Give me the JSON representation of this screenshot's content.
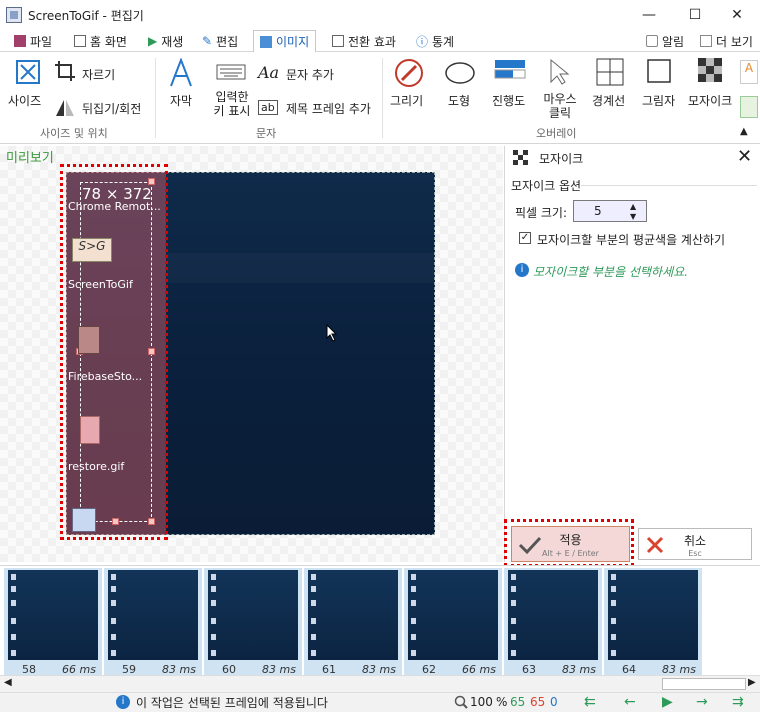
{
  "window": {
    "title": "ScreenToGif - 편집기",
    "minimize": "—",
    "maximize": "☐",
    "close": "✕"
  },
  "tabs": [
    {
      "label": "파일"
    },
    {
      "label": "홈 화면"
    },
    {
      "label": "재생"
    },
    {
      "label": "편집"
    },
    {
      "label": "이미지"
    },
    {
      "label": "전환 효과"
    },
    {
      "label": "통계"
    }
  ],
  "tabs_right": {
    "alarm": "알림",
    "more": "더 보기"
  },
  "ribbon": {
    "size_pos": {
      "resize": "사이즈",
      "crop": "자르기",
      "flip": "뒤집기/회전",
      "group": "사이즈 및 위치"
    },
    "text": {
      "caption": "자막",
      "keystrokes": "입력한 키 표시",
      "free_text": "문자 추가",
      "title_frame": "제목 프레임 추가",
      "group": "문자",
      "aa": "Aa",
      "ab": "ab"
    },
    "overlay": {
      "draw": "그리기",
      "shape": "도형",
      "progress": "진행도",
      "mouse_clicks": "마우스 클릭",
      "border": "경계선",
      "shadow": "그림자",
      "obfuscate": "모자이크",
      "group": "오버레이"
    }
  },
  "preview": {
    "label": "미리보기",
    "selection_size": "78 × 372"
  },
  "desktop_icons": [
    {
      "label": "Chrome Remot..."
    },
    {
      "label": "ScreenToGif"
    },
    {
      "label": "FirebaseSto..."
    },
    {
      "label": "restore.gif"
    },
    {
      "label": "S>G"
    }
  ],
  "panel": {
    "title": "모자이크",
    "options_header": "모자이크 옵션",
    "pixel_size_label": "픽셀 크기:",
    "pixel_size_value": "5",
    "average_checkbox_label": "모자이크할 부분의 평균색을 계산하기",
    "average_checked": true,
    "info": "모자이크할 부분을 선택하세요."
  },
  "buttons": {
    "apply": "적용",
    "apply_shortcut": "Alt + E / Enter",
    "cancel": "취소",
    "cancel_shortcut": "Esc"
  },
  "frames": [
    {
      "num": "58",
      "ms": "66 ms"
    },
    {
      "num": "59",
      "ms": "83 ms"
    },
    {
      "num": "60",
      "ms": "83 ms"
    },
    {
      "num": "61",
      "ms": "83 ms"
    },
    {
      "num": "62",
      "ms": "66 ms"
    },
    {
      "num": "63",
      "ms": "83 ms"
    },
    {
      "num": "64",
      "ms": "83 ms"
    }
  ],
  "status": {
    "message": "이 작업은 선택된 프레임에 적용됩니다",
    "zoom": "100",
    "zoom_unit": "%",
    "total_frames": "65",
    "selected_frames": "65",
    "current": "0"
  },
  "colors": {
    "accent_green": "#2e9a5a",
    "selection_red": "#e00000",
    "info_blue": "#2477c9"
  }
}
